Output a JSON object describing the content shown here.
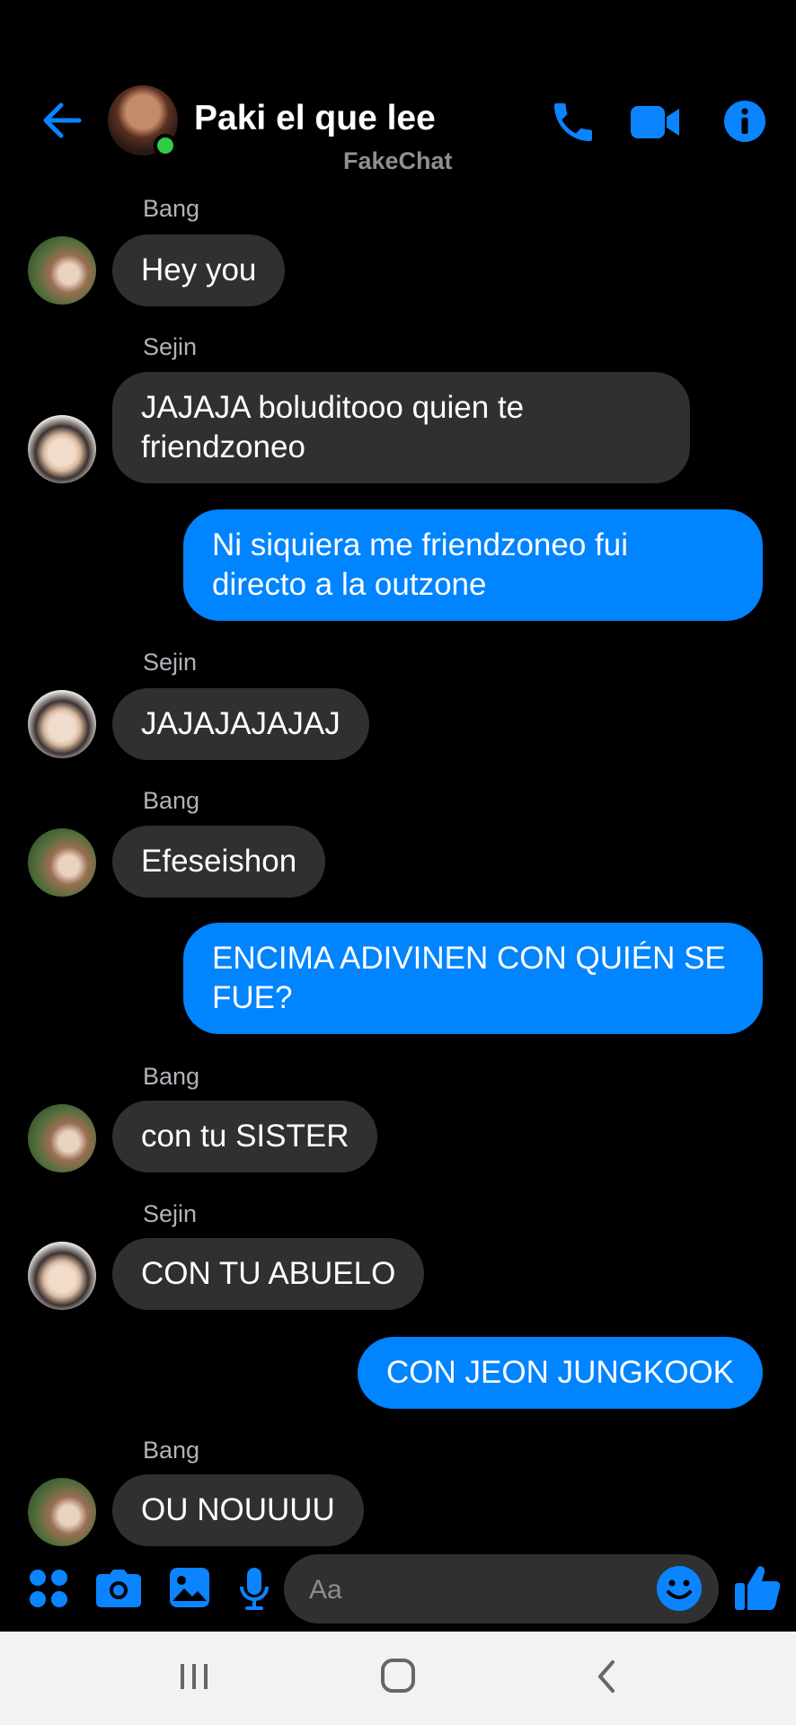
{
  "header": {
    "back_icon": "arrow-left-icon",
    "title": "Paki el que lee",
    "subtitle": "FakeChat",
    "online": true,
    "actions": [
      "phone-icon",
      "video-camera-icon",
      "info-icon"
    ]
  },
  "messages": [
    {
      "side": "in",
      "sender": "Bang",
      "avatar": "bang",
      "text": "Hey you"
    },
    {
      "side": "in",
      "sender": "Sejin",
      "avatar": "sejin",
      "text": "JAJAJA boluditooo quien te\nfriendzoneo"
    },
    {
      "side": "out",
      "text": "Ni siquiera me friendzoneo fui\ndirecto a la outzone"
    },
    {
      "side": "in",
      "sender": "Sejin",
      "avatar": "sejin",
      "text": "JAJAJAJAJAJ"
    },
    {
      "side": "in",
      "sender": "Bang",
      "avatar": "bang",
      "text": "Efeseishon"
    },
    {
      "side": "out",
      "text": "ENCIMA ADIVINEN CON QUIÉN SE\nFUE?"
    },
    {
      "side": "in",
      "sender": "Bang",
      "avatar": "bang",
      "text": "con tu SISTER"
    },
    {
      "side": "in",
      "sender": "Sejin",
      "avatar": "sejin",
      "text": "CON TU ABUELO"
    },
    {
      "side": "out",
      "text": "CON JEON JUNGKOOK"
    },
    {
      "side": "in",
      "sender": "Bang",
      "avatar": "bang",
      "text": "OU NOUUUU"
    }
  ],
  "composer": {
    "placeholder": "Aa",
    "icons": [
      "apps-grid-icon",
      "camera-icon",
      "image-icon",
      "microphone-icon",
      "emoji-icon",
      "thumbs-up-icon"
    ]
  },
  "colors": {
    "accent": "#0084ff",
    "incoming_bubble": "#303030",
    "background": "#000000",
    "online": "#31cc46"
  }
}
